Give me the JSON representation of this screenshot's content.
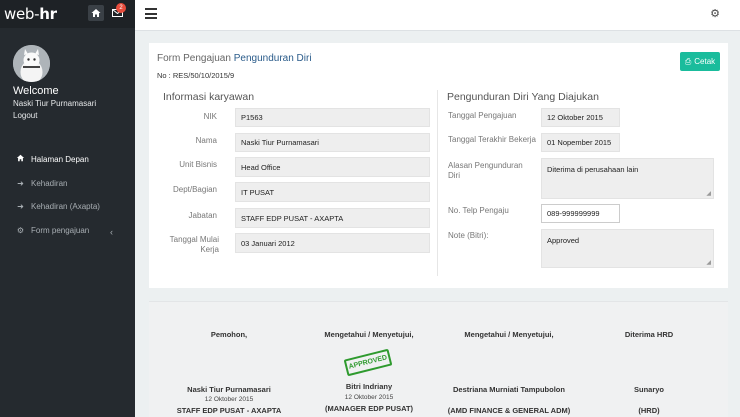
{
  "app": {
    "logo_prefix": "web-",
    "logo_suffix": "hr",
    "notif_count": "2"
  },
  "sidebar": {
    "welcome": "Welcome",
    "username": "Naski Tiur Purnamasari",
    "logout": "Logout",
    "items": [
      {
        "label": "Halaman Depan",
        "icon": "home-icon"
      },
      {
        "label": "Kehadiran",
        "icon": "sign-in-icon"
      },
      {
        "label": "Kehadiran (Axapta)",
        "icon": "sign-in-icon"
      },
      {
        "label": "Form pengajuan",
        "icon": "gear-icon"
      }
    ]
  },
  "form": {
    "title_prefix": "Form Pengajuan",
    "title_accent": "Pengunduran Diri",
    "doc_no": "No : RES/50/10/2015/9",
    "print_label": "Cetak"
  },
  "left": {
    "heading": "Informasi karyawan",
    "fields": [
      {
        "label": "NIK",
        "value": "P1563"
      },
      {
        "label": "Nama",
        "value": "Naski Tiur Purnamasari"
      },
      {
        "label": "Unit Bisnis",
        "value": "Head Office"
      },
      {
        "label": "Dept/Bagian",
        "value": "IT PUSAT"
      },
      {
        "label": "Jabatan",
        "value": "STAFF EDP PUSAT - AXAPTA"
      },
      {
        "label": "Tanggal Mulai Kerja",
        "value": "03 Januari 2012"
      }
    ]
  },
  "right": {
    "heading": "Pengunduran Diri Yang Diajukan",
    "tanggal_pengajuan_label": "Tanggal Pengajuan",
    "tanggal_pengajuan": "12 Oktober 2015",
    "tanggal_terakhir_label": "Tanggal Terakhir Bekerja",
    "tanggal_terakhir": "01 Nopember 2015",
    "alasan_label": "Alasan Pengunduran Diri",
    "alasan": "Diterima di perusahaan lain",
    "telp_label": "No. Telp Pengaju",
    "telp": "089-999999999",
    "note_label": "Note (Bitri):",
    "note": "Approved"
  },
  "signatures": [
    {
      "role": "Pemohon,",
      "name": "Naski Tiur Purnamasari",
      "date": "12 Oktober 2015",
      "position": "STAFF EDP PUSAT - AXAPTA"
    },
    {
      "role": "Mengetahui / Menyetujui,",
      "name": "Bitri Indriany",
      "date": "12 Oktober 2015",
      "position": "(MANAGER EDP PUSAT)",
      "stamp": "APPROVED"
    },
    {
      "role": "Mengetahui / Menyetujui,",
      "name": "Destriana Murniati Tampubolon",
      "date": "",
      "position": "(AMD FINANCE & GENERAL ADM)"
    },
    {
      "role": "Diterima HRD",
      "name": "Sunaryo",
      "date": "",
      "position": "(HRD)"
    }
  ]
}
